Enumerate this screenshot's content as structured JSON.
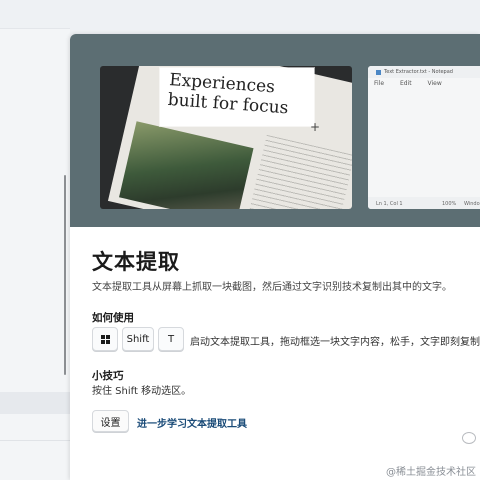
{
  "hero": {
    "book_heading": "Experiences\nbuilt for focus",
    "notepad_title": "Text Extractor.txt - Notepad",
    "notepad_menu": [
      "File",
      "Edit",
      "View"
    ],
    "notepad_status": [
      "Ln 1, Col 1",
      "100%",
      "Windo"
    ]
  },
  "title": "文本提取",
  "description": "文本提取工具从屏幕上抓取一块截图，然后通过文字识别技术复制出其中的文字。",
  "how_to_use": {
    "heading": "如何使用",
    "keys": [
      "Shift",
      "T"
    ],
    "key_icon": "windows-logo-icon",
    "instruction": "启动文本提取工具，拖动框选一块文字内容，松手，文字即刻复制到"
  },
  "tips": {
    "heading": "小技巧",
    "text": "按住 Shift 移动选区。"
  },
  "buttons": {
    "settings": "设置",
    "learn_more": "进一步学习文本提取工具"
  },
  "watermark": "@稀土掘金技术社区",
  "colors": {
    "hero_background": "#5c6e73",
    "link": "#1a4b78"
  }
}
